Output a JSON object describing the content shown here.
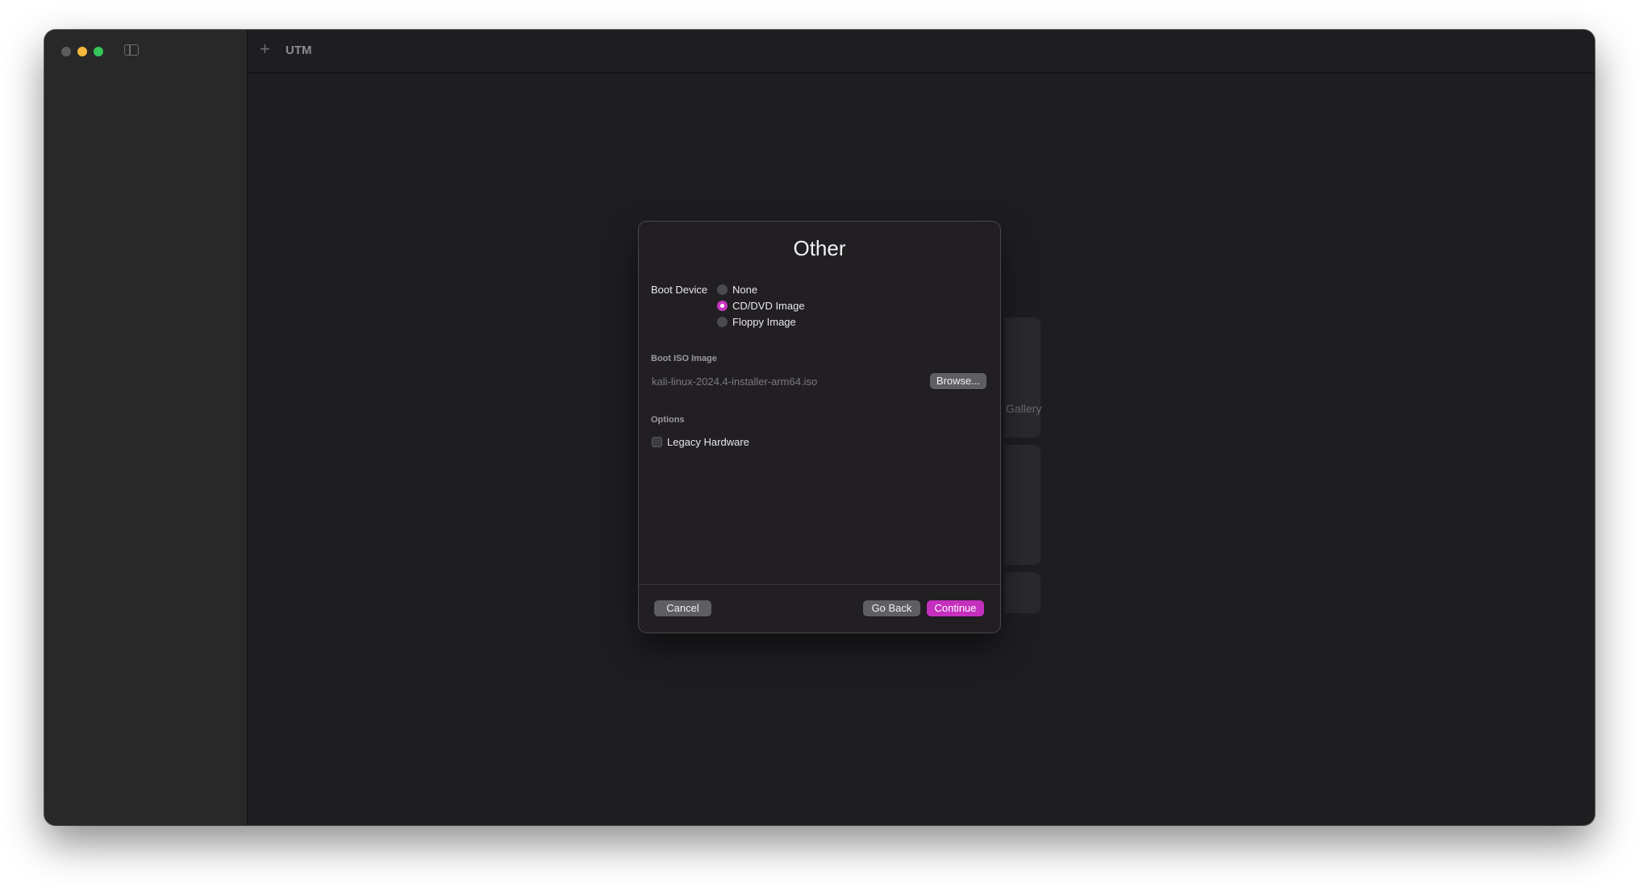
{
  "app": {
    "title": "UTM"
  },
  "background_cards": {
    "gallery_fragment": "Gallery"
  },
  "dialog": {
    "title": "Other",
    "boot_device_label": "Boot Device",
    "boot_device_options": [
      "None",
      "CD/DVD Image",
      "Floppy Image"
    ],
    "boot_device_selected": "CD/DVD Image",
    "boot_iso_section": "Boot ISO Image",
    "boot_iso_path": "kali-linux-2024.4-installer-arm64.iso",
    "browse_label": "Browse...",
    "options_section": "Options",
    "legacy_hardware_label": "Legacy Hardware",
    "legacy_hardware_checked": false,
    "cancel_label": "Cancel",
    "go_back_label": "Go Back",
    "continue_label": "Continue"
  },
  "colors": {
    "accent": "#c42fbe",
    "window_bg": "#1e1d20",
    "sidebar_bg": "#282828",
    "dialog_bg": "#221f23"
  }
}
